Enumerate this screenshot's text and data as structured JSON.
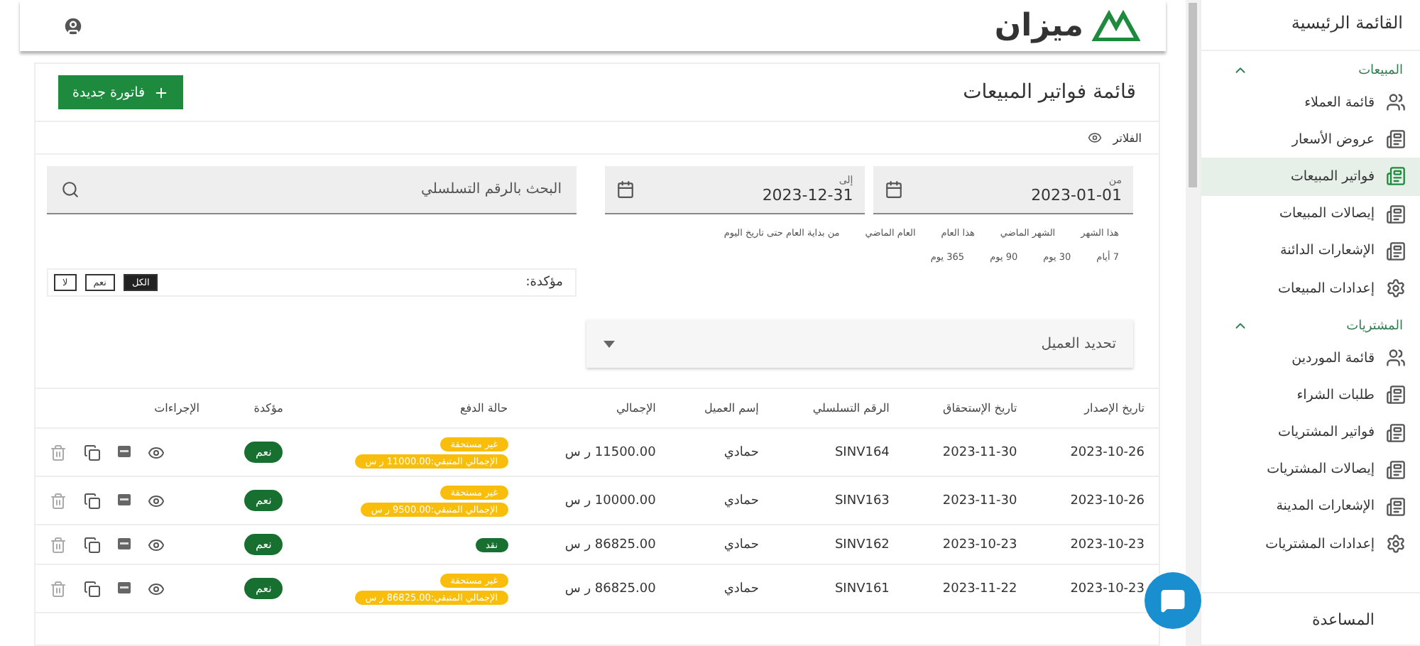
{
  "header": {
    "logo_text": "ميزان"
  },
  "sidebar": {
    "title": "القائمة الرئيسية",
    "groups": [
      {
        "label": "المبيعات",
        "expanded": true,
        "items": [
          {
            "label": "قائمة العملاء",
            "kind": "people",
            "selected": false
          },
          {
            "label": "عروض الأسعار",
            "kind": "document",
            "selected": false
          },
          {
            "label": "فواتير المبيعات",
            "kind": "document",
            "selected": true
          },
          {
            "label": "إيصالات المبيعات",
            "kind": "document",
            "selected": false
          },
          {
            "label": "الإشعارات الدائنة",
            "kind": "document",
            "selected": false
          },
          {
            "label": "إعدادات المبيعات",
            "kind": "settings",
            "selected": false
          }
        ]
      },
      {
        "label": "المشتريات",
        "expanded": true,
        "items": [
          {
            "label": "قائمة الموردين",
            "kind": "people",
            "selected": false
          },
          {
            "label": "طلبات الشراء",
            "kind": "document",
            "selected": false
          },
          {
            "label": "فواتير المشتريات",
            "kind": "document",
            "selected": false
          },
          {
            "label": "إيصالات المشتريات",
            "kind": "document",
            "selected": false
          },
          {
            "label": "الإشعارات المدينة",
            "kind": "document",
            "selected": false
          },
          {
            "label": "إعدادات المشتريات",
            "kind": "settings",
            "selected": false
          }
        ]
      }
    ],
    "help": "المساعدة"
  },
  "page": {
    "title": "قائمة فواتير المبيعات",
    "new_button": "فاتورة جديدة",
    "filters_label": "الفلاتر"
  },
  "filters": {
    "from": {
      "label": "من",
      "value": "2023-01-01"
    },
    "to": {
      "label": "إلى",
      "value": "2023-12-31"
    },
    "quick_ranges": [
      [
        "هذا الشهر",
        "الشهر الماضي",
        "هذا العام",
        "العام الماضي",
        "من بداية العام حتى تاريخ اليوم"
      ],
      [
        "7 أيام",
        "30 يوم",
        "90 يوم",
        "365 يوم"
      ]
    ],
    "search": {
      "placeholder": "البحث بالرقم التسلسلي"
    },
    "confirmed": {
      "label": "مؤكدة:",
      "options": [
        {
          "label": "الكل",
          "selected": true
        },
        {
          "label": "نعم",
          "selected": false
        },
        {
          "label": "لا",
          "selected": false
        }
      ]
    },
    "customer": {
      "placeholder": "تحديد العميل"
    }
  },
  "table": {
    "columns": [
      "تاريخ الإصدار",
      "تاريخ الإستحقاق",
      "الرقم التسلسلي",
      "إسم العميل",
      "الإجمالي",
      "حالة الدفع",
      "مؤكدة",
      "الإجراءات"
    ],
    "rows": [
      {
        "issue_date": "2023-10-26",
        "due_date": "2023-11-30",
        "serial": "SINV164",
        "customer": "حمادي",
        "total": "11500.00 ر س",
        "payment": [
          {
            "kind": "unpaid",
            "text": "غير مستحقة"
          },
          {
            "kind": "unpaid",
            "text": "الإجمالي المتبقي:11000.00 ر س"
          }
        ],
        "confirmed": "نعم"
      },
      {
        "issue_date": "2023-10-26",
        "due_date": "2023-11-30",
        "serial": "SINV163",
        "customer": "حمادي",
        "total": "10000.00 ر س",
        "payment": [
          {
            "kind": "unpaid",
            "text": "غير مستحقة"
          },
          {
            "kind": "unpaid",
            "text": "الإجمالي المتبقي:9500.00 ر س"
          }
        ],
        "confirmed": "نعم"
      },
      {
        "issue_date": "2023-10-23",
        "due_date": "2023-10-23",
        "serial": "SINV162",
        "customer": "حمادي",
        "total": "86825.00 ر س",
        "payment": [
          {
            "kind": "paid",
            "text": "نقد"
          }
        ],
        "confirmed": "نعم"
      },
      {
        "issue_date": "2023-10-23",
        "due_date": "2023-11-22",
        "serial": "SINV161",
        "customer": "حمادي",
        "total": "86825.00 ر س",
        "payment": [
          {
            "kind": "unpaid",
            "text": "غير مستحقة"
          },
          {
            "kind": "unpaid",
            "text": "الإجمالي المتبقي:86825.00 ر س"
          }
        ],
        "confirmed": "نعم"
      }
    ]
  }
}
